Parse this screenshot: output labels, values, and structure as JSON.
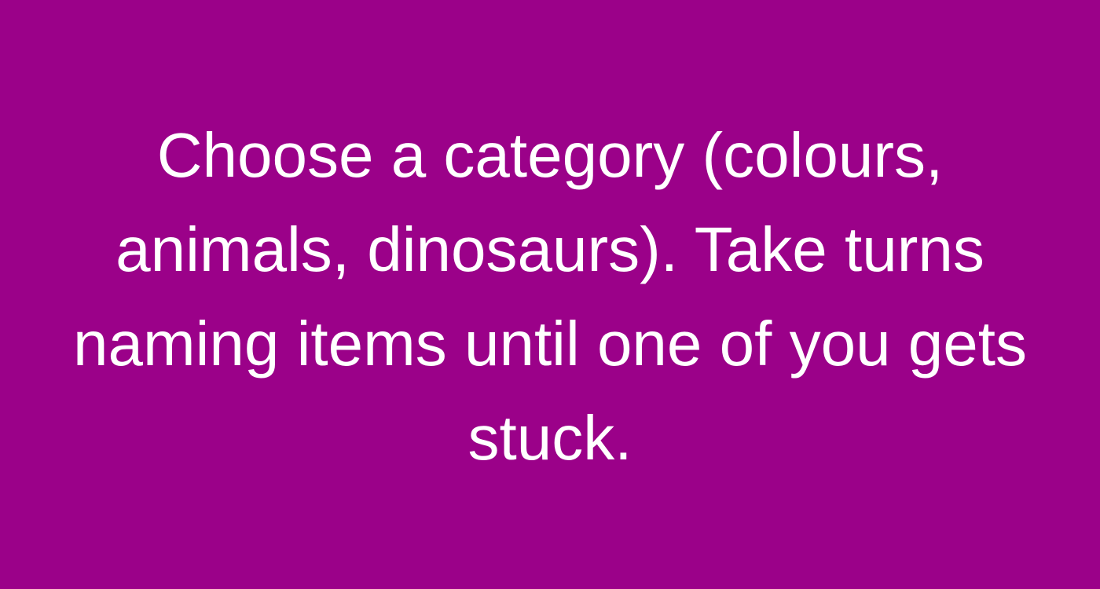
{
  "colors": {
    "background": "#9b0189",
    "text": "#ffffff"
  },
  "card": {
    "message": "Choose a category (colours, animals, dinosaurs). Take turns naming items until one of you gets stuck."
  }
}
